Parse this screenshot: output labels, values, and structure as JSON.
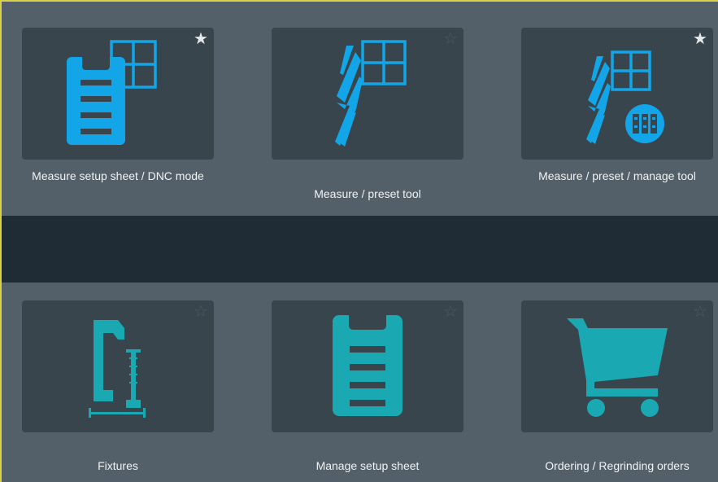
{
  "colors": {
    "frame_border": "#d7d24a",
    "section_background": "#536069",
    "divider_background": "#1f2b35",
    "tile_background": "#39454d",
    "icon_blue": "#12a6e8",
    "icon_teal": "#1aa8b3",
    "star_on": "#e6e9ec",
    "star_off": "#4d5a62",
    "label_text": "#f1f3f4"
  },
  "tiles_top": [
    {
      "label": "Measure setup sheet / DNC mode",
      "icon": "setup-sheet-grid-icon",
      "favorite": true
    },
    {
      "label": "Measure / preset tool",
      "icon": "drill-grid-icon",
      "favorite": false
    },
    {
      "label": "Measure / preset / manage tool",
      "icon": "drill-grid-manage-icon",
      "favorite": true
    }
  ],
  "tiles_bottom": [
    {
      "label": "Fixtures",
      "icon": "clamp-icon",
      "favorite": false
    },
    {
      "label": "Manage setup sheet",
      "icon": "clipboard-icon",
      "favorite": false
    },
    {
      "label": "Ordering / Regrinding orders",
      "icon": "shopping-cart-icon",
      "favorite": false
    }
  ],
  "glyphs": {
    "star_filled": "★",
    "star_outline": "☆"
  }
}
